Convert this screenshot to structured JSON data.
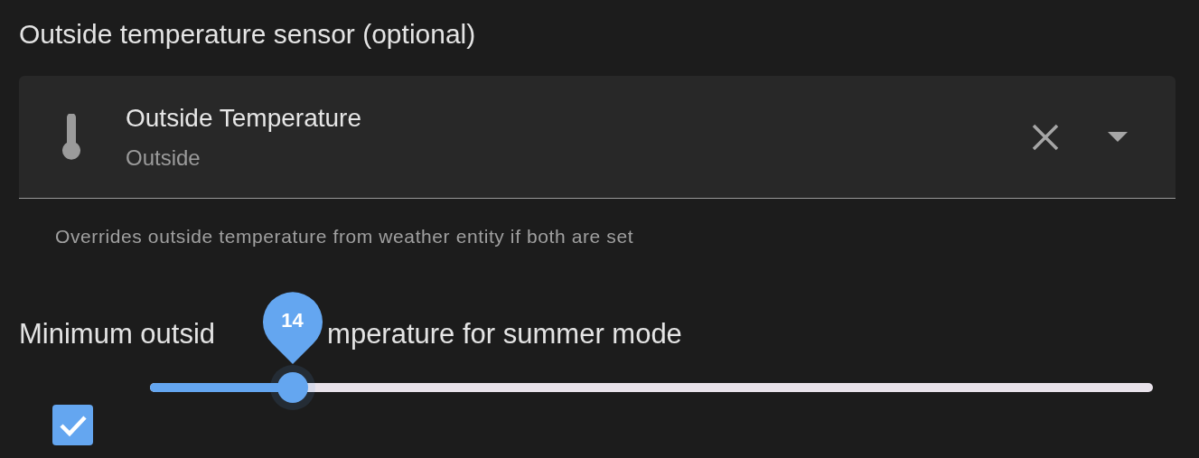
{
  "sensor_section": {
    "title": "Outside temperature sensor (optional)",
    "field": {
      "primary": "Outside Temperature",
      "secondary": "Outside"
    },
    "helper": "Overrides outside temperature from weather entity if both are set"
  },
  "summer_section": {
    "title_parts": [
      "Minimum outsid",
      "mperature for summer mode"
    ],
    "enabled": {
      "checked": true
    },
    "slider": {
      "level": 0.142,
      "value": "14"
    }
  }
}
